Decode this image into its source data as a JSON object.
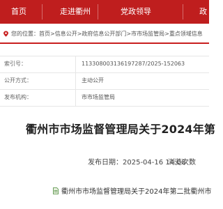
{
  "nav": {
    "items": [
      "首页",
      "走进衢州",
      "党政领导",
      "政"
    ]
  },
  "breadcrumb": {
    "prefix": "您的位置：",
    "items": [
      "首页",
      "信息公开",
      "政府信息公开部门",
      "市市场监管局",
      "重点领域信息"
    ],
    "separator": " > "
  },
  "meta": {
    "rows": [
      {
        "label": "索引号：",
        "value": "113308003136197287/2025-152063"
      },
      {
        "label": "公开方式：",
        "value": "主动公开"
      },
      {
        "label": "发布机构：",
        "value": "市市场监管局"
      }
    ]
  },
  "article": {
    "title": "衢州市市场监督管理局关于2024年第",
    "publish_label": "发布日期：",
    "publish_date": "2025-04-16 14:06",
    "views_label": "浏览次数"
  },
  "attachment": {
    "name": "衢州市市场监督管理局关于2024年第二批衢州市"
  },
  "colors": {
    "nav_bg": "#bf1e1e",
    "accent_red": "#c81e1e"
  }
}
